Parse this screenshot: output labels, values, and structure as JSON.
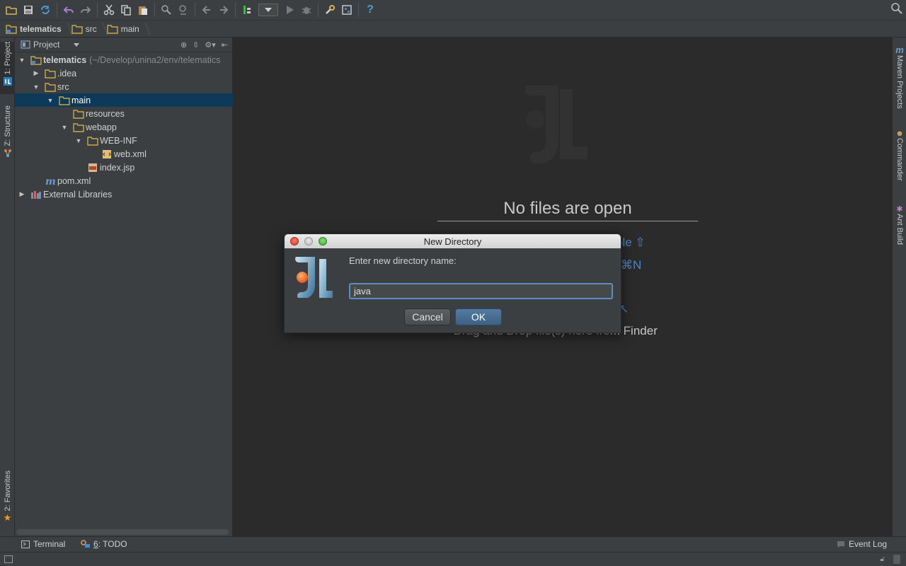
{
  "toolbar": {
    "icons": [
      "open-folder-icon",
      "save-icon",
      "sync-icon",
      "undo-icon",
      "redo-icon",
      "cut-icon",
      "copy-icon",
      "paste-icon",
      "find-icon",
      "replace-icon",
      "back-icon",
      "forward-icon",
      "build-icon",
      "run-config-combo",
      "run-icon",
      "debug-icon",
      "settings-icon",
      "project-structure-icon",
      "help-icon",
      "search-everywhere-icon"
    ],
    "help_label": "?"
  },
  "breadcrumbs": [
    "telematics",
    "src",
    "main"
  ],
  "left_strip": {
    "project_tab": "1: Project",
    "structure_tab": "Z: Structure",
    "favorites_tab": "2: Favorites"
  },
  "right_strip": {
    "maven_tab": "Maven Projects",
    "commander_tab": "Commander",
    "ant_tab": "Ant Build"
  },
  "project_panel": {
    "title": "Project",
    "tree": [
      {
        "label": "telematics",
        "path": "(~/Develop/unina2/env/telematics",
        "level": 0,
        "arrow": "open",
        "icon": "module-folder"
      },
      {
        "label": ".idea",
        "level": 1,
        "arrow": "closed",
        "icon": "folder"
      },
      {
        "label": "src",
        "level": 1,
        "arrow": "open",
        "icon": "folder"
      },
      {
        "label": "main",
        "level": 2,
        "arrow": "open",
        "icon": "folder",
        "selected": true
      },
      {
        "label": "resources",
        "level": 3,
        "arrow": "none",
        "icon": "folder"
      },
      {
        "label": "webapp",
        "level": 3,
        "arrow": "open",
        "icon": "folder"
      },
      {
        "label": "WEB-INF",
        "level": 4,
        "arrow": "open",
        "icon": "folder"
      },
      {
        "label": "web.xml",
        "level": 5,
        "arrow": "none",
        "icon": "xml-file"
      },
      {
        "label": "index.jsp",
        "level": 4,
        "arrow": "none",
        "icon": "jsp-file"
      },
      {
        "label": "pom.xml",
        "level": 1,
        "arrow": "none",
        "icon": "maven-file"
      },
      {
        "label": "External Libraries",
        "level": 0,
        "arrow": "closed",
        "icon": "libraries"
      }
    ]
  },
  "editor": {
    "empty_title": "No files are open",
    "hint_1_tail": "ble",
    "hint_1_sym": "⇧",
    "hint_2_tail": "⌘N",
    "hint_3_tail": "↖",
    "drag_hint_prefix": "• Drag and Drop file(s) here fro",
    "drag_hint_suffix": "m Finder"
  },
  "dialog": {
    "title": "New Directory",
    "prompt": "Enter new directory name:",
    "input_value": "java",
    "cancel_label": "Cancel",
    "ok_label": "OK"
  },
  "bottom_tools": {
    "terminal": "Terminal",
    "todo_mnemonic": "6",
    "todo_rest": ": TODO",
    "event_log": "Event Log"
  },
  "colors": {
    "selection": "#0d3a58",
    "panel": "#3c3f41",
    "editor": "#2b2b2b",
    "accent_blue": "#4a88c7",
    "folder": "#c9a84e"
  }
}
